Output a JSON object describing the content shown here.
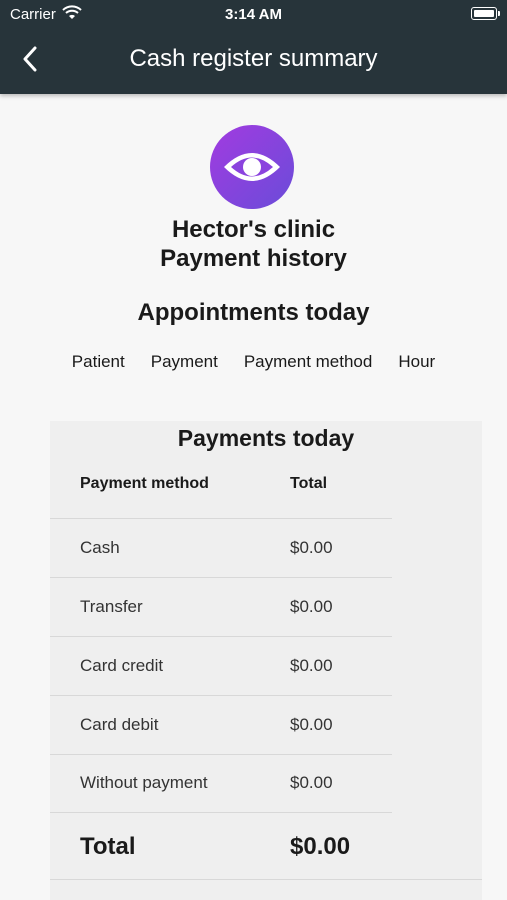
{
  "status_bar": {
    "carrier": "Carrier",
    "time": "3:14 AM"
  },
  "app_bar": {
    "title": "Cash register summary",
    "back_icon": "chevron-left-icon"
  },
  "colors": {
    "app_bar_bg": "#27343a",
    "logo_gradient_start": "#a23be0",
    "logo_gradient_end": "#6a4cd9"
  },
  "header": {
    "logo_icon": "eye-icon",
    "clinic_name": "Hector's clinic",
    "subtitle": "Payment history"
  },
  "appointments": {
    "title": "Appointments today",
    "columns": [
      "Patient",
      "Payment",
      "Payment method",
      "Hour"
    ]
  },
  "payments": {
    "title": "Payments today",
    "columns": [
      "Payment method",
      "Total"
    ],
    "rows": [
      {
        "method": "Cash",
        "total": "$0.00"
      },
      {
        "method": "Transfer",
        "total": "$0.00"
      },
      {
        "method": "Card credit",
        "total": "$0.00"
      },
      {
        "method": "Card debit",
        "total": "$0.00"
      },
      {
        "method": "Without payment",
        "total": "$0.00"
      }
    ],
    "total_label": "Total",
    "total_value": "$0.00"
  }
}
